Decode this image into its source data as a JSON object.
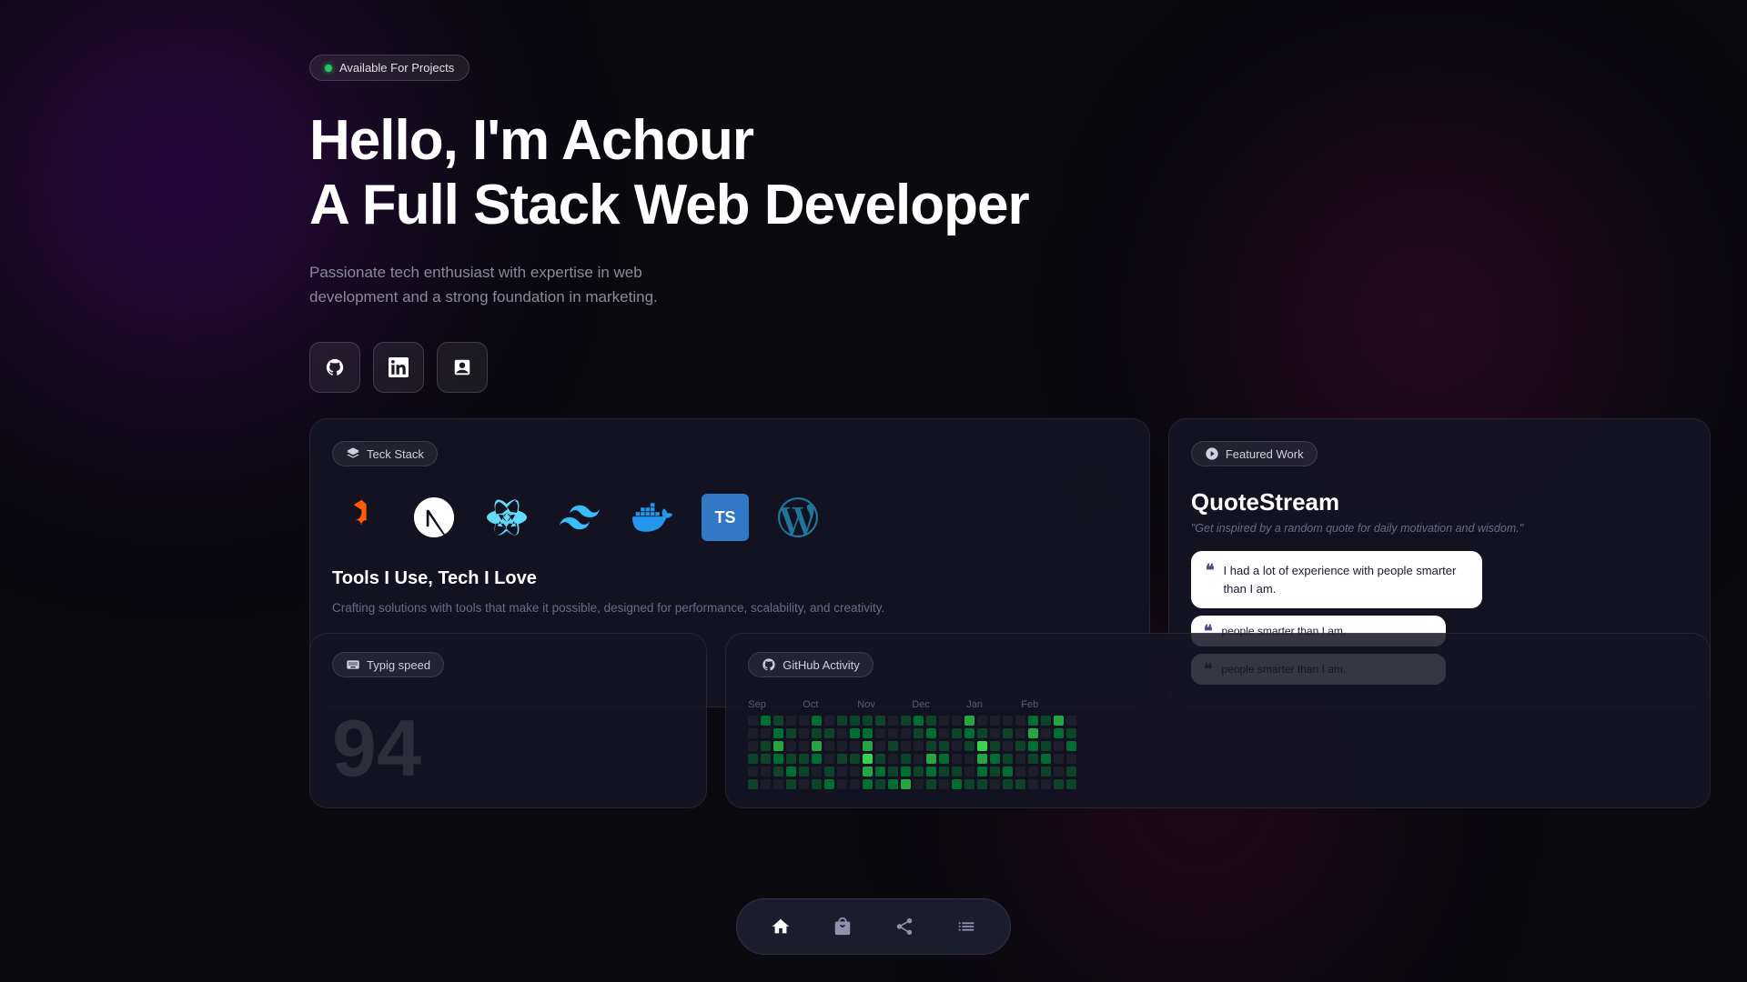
{
  "hero": {
    "available_label": "Available For Projects",
    "heading_line1": "Hello, I'm Achour",
    "heading_line2": "A Full Stack Web Developer",
    "description": "Passionate tech enthusiast with expertise in web development and a strong foundation in marketing."
  },
  "social": {
    "github_label": "GitHub",
    "linkedin_label": "LinkedIn",
    "portfolio_label": "Portfolio"
  },
  "tech_card": {
    "badge": "Teck Stack",
    "title": "Tools I Use, Tech I Love",
    "description": "Crafting solutions with tools that make it possible, designed for performance, scalability, and creativity.",
    "icons": [
      "Astro",
      "Next.js",
      "React",
      "Tailwind",
      "Docker",
      "TypeScript",
      "WordPress"
    ]
  },
  "featured_card": {
    "badge": "Featured Work",
    "project_name": "QuoteStream",
    "tagline": "\"Get inspired by a random quote for daily motivation and wisdom.\"",
    "quotes": [
      "I had a lot of experience with people smarter than I am.",
      "people smarter than I am.",
      "people smarter than I am."
    ]
  },
  "typing_card": {
    "badge": "Typig speed",
    "number": "94"
  },
  "github_card": {
    "badge": "GitHub Activity",
    "months": [
      "Sep",
      "Oct",
      "Nov",
      "Dec",
      "Jan",
      "Feb"
    ]
  },
  "nav": {
    "items": [
      "home",
      "bag",
      "share",
      "list"
    ]
  },
  "colors": {
    "accent_green": "#22c55e",
    "accent_purple": "#7c3aed",
    "bg_card": "rgba(20,20,35,0.85)"
  }
}
